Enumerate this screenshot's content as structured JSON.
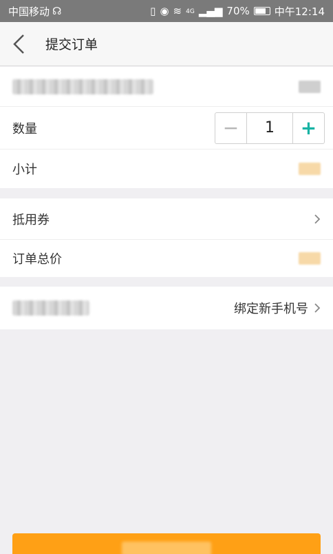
{
  "status_bar": {
    "carrier": "中国移动",
    "network": "4G",
    "battery": "70%",
    "time": "中午12:14"
  },
  "nav": {
    "title": "提交订单"
  },
  "order": {
    "quantity_label": "数量",
    "quantity_value": "1",
    "minus_symbol": "−",
    "plus_symbol": "+",
    "subtotal_label": "小计"
  },
  "pricing": {
    "coupon_label": "抵用券",
    "total_label": "订单总价"
  },
  "phone": {
    "bind_label": "绑定新手机号"
  },
  "colors": {
    "accent": "#17b3a4",
    "submit": "#ffa015",
    "price": "#f7d9a8"
  }
}
